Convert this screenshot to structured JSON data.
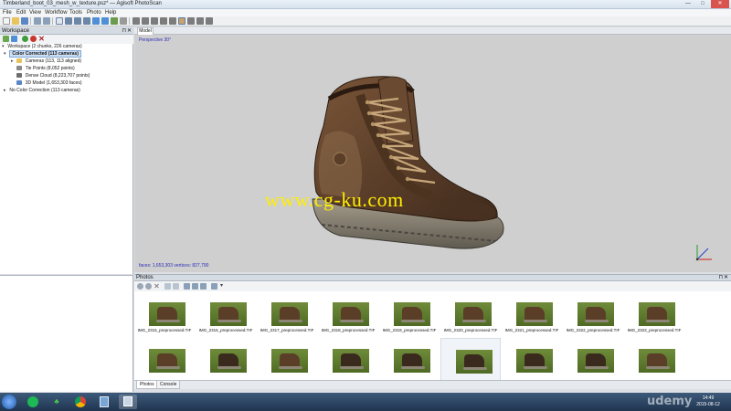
{
  "window": {
    "title": "Timberland_boot_03_mesh_w_texture.psz* — Agisoft PhotoScan",
    "min": "—",
    "max": "□",
    "close": "✕"
  },
  "menu": [
    "File",
    "Edit",
    "View",
    "Workflow",
    "Tools",
    "Photo",
    "Help"
  ],
  "workspace": {
    "header": "Workspace",
    "pin": "⊓",
    "close": "✕",
    "tree": {
      "root": "Workspace (2 chunks, 226 cameras)",
      "chunk1": "Color Corrected (113 cameras)",
      "cameras": "Cameras (113, 113 aligned)",
      "tie_points": "Tie Points (8,052 points)",
      "dense_cloud": "Dense Cloud (8,223,707 points)",
      "model": "3D Model (1,653,303 faces)",
      "chunk2": "No Color Correction (113 cameras)"
    }
  },
  "model_view": {
    "tab": "Model",
    "perspective": "Perspective 30°",
    "stats": "faces: 1,653,303 vertices: 827,790",
    "watermark": "www.cg-ku.com"
  },
  "photos": {
    "header": "Photos",
    "pin": "⊓",
    "close": "✕",
    "captions": [
      "IMG_2315_preprocessed.TIF",
      "IMG_2316_preprocessed.TIF",
      "IMG_2317_preprocessed.TIF",
      "IMG_2318_preprocessed.TIF",
      "IMG_2319_preprocessed.TIF",
      "IMG_2320_preprocessed.TIF",
      "IMG_2321_preprocessed.TIF",
      "IMG_2322_preprocessed.TIF",
      "IMG_2323_preprocessed.TIF"
    ],
    "tabs": [
      "Photos",
      "Console"
    ]
  },
  "taskbar": {
    "time": "14:49",
    "date": "2015-08-12",
    "brand": "udemy"
  },
  "colors": {
    "viewport_bg": "#cfcfcf",
    "selection": "#cfe0f6",
    "watermark": "#ffee00"
  }
}
